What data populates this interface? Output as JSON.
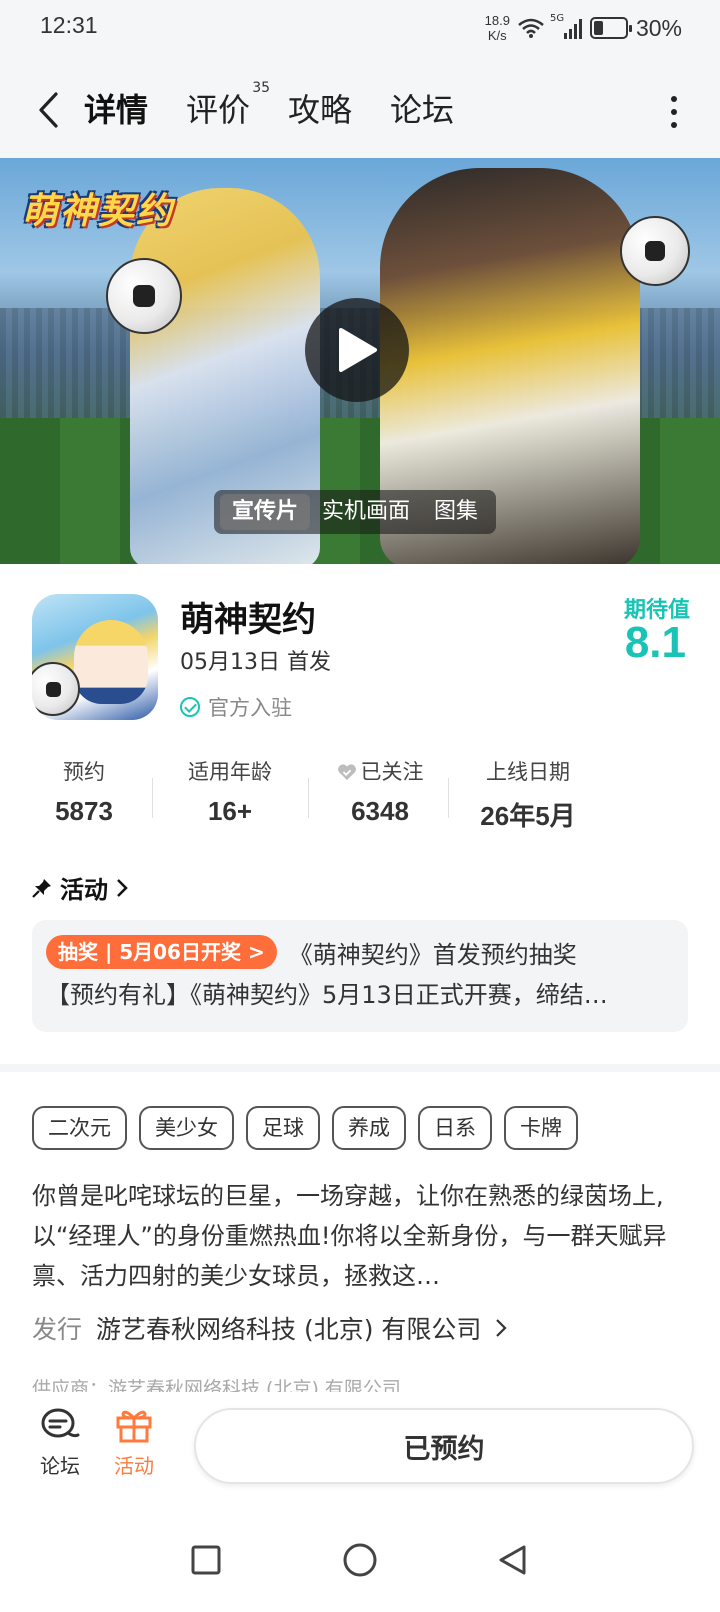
{
  "status_bar": {
    "time": "12:31",
    "net_speed_value": "18.9",
    "net_speed_unit": "K/s",
    "signal_label": "5G",
    "battery_percent": "30%",
    "battery_level": 0.3
  },
  "nav": {
    "tabs": [
      {
        "label": "详情",
        "active": true
      },
      {
        "label": "评价",
        "badge": "35"
      },
      {
        "label": "攻略"
      },
      {
        "label": "论坛"
      }
    ]
  },
  "banner": {
    "logo_text": "萌神契约",
    "media_tabs": [
      "宣传片",
      "实机画面",
      "图集"
    ],
    "active_media_tab": "宣传片"
  },
  "app": {
    "name": "萌神契约",
    "release": "05月13日 首发",
    "official": "官方入驻",
    "expect_label": "期待值",
    "expect_value": "8.1"
  },
  "stats": [
    {
      "label": "预约",
      "value": "5873"
    },
    {
      "label": "适用年龄",
      "value": "16+"
    },
    {
      "label": "已关注",
      "value": "6348"
    },
    {
      "label": "上线日期",
      "value": "26年5月"
    }
  ],
  "activity": {
    "heading": "活动",
    "badge": "抽奖 | 5月06日开奖 >",
    "title1": "《萌神契约》首发预约抽奖",
    "title2": "【预约有礼】《萌神契约》5月13日正式开赛，缔结…"
  },
  "tags": [
    "二次元",
    "美少女",
    "足球",
    "养成",
    "日系",
    "卡牌"
  ],
  "description": "你曾是叱咤球坛的巨星，一场穿越，让你在熟悉的绿茵场上,以“经理人”的身份重燃热血!你将以全新身份，与一群天赋异禀、活力四射的美少女球员，拯救这…",
  "publisher": {
    "label": "发行",
    "name": "游艺春秋网络科技 (北京) 有限公司"
  },
  "supplier": "供应商：游艺春秋网络科技 (北京) 有限公司",
  "bottom_bar": {
    "forum_label": "论坛",
    "activity_label": "活动",
    "reserve_label": "已预约",
    "accent": "#ff7a3d"
  },
  "colors": {
    "teal": "#19c4b6",
    "orange": "#ff6d3a"
  }
}
